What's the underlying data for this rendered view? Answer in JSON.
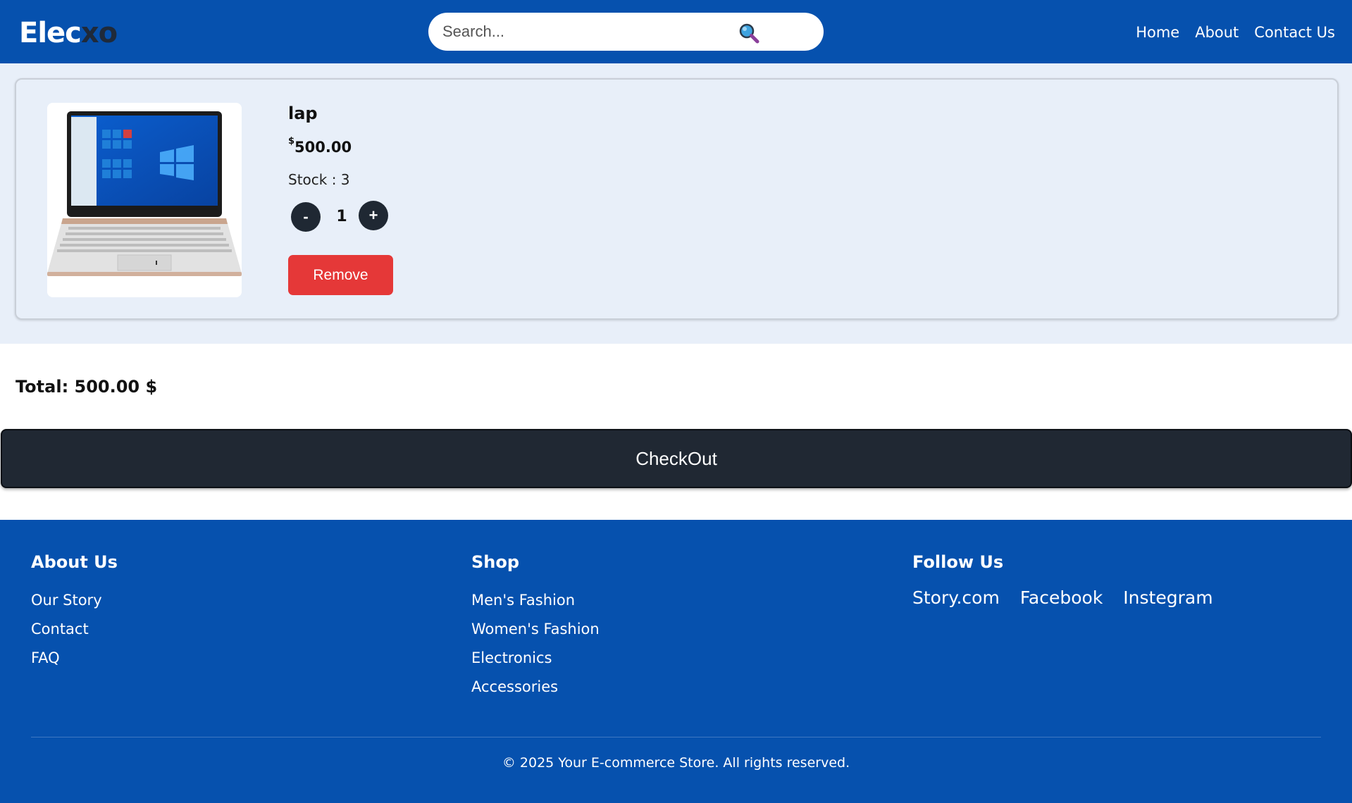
{
  "header": {
    "logo_part1": "Elec",
    "logo_part2": "xo",
    "search_placeholder": "Search...",
    "nav": [
      "Home",
      "About",
      "Contact Us"
    ]
  },
  "cart": {
    "items": [
      {
        "name": "lap",
        "currency_symbol": "$",
        "price": "500.00",
        "stock_label": "Stock : 3",
        "quantity": "1",
        "minus_label": "-",
        "plus_label": "+",
        "remove_label": "Remove"
      }
    ],
    "total_label": "Total: 500.00 $",
    "checkout_label": "CheckOut"
  },
  "footer": {
    "about": {
      "title": "About Us",
      "links": [
        "Our Story",
        "Contact",
        "FAQ"
      ]
    },
    "shop": {
      "title": "Shop",
      "links": [
        "Men's Fashion",
        "Women's Fashion",
        "Electronics",
        "Accessories"
      ]
    },
    "follow": {
      "title": "Follow Us",
      "links": [
        "Story.com",
        "Facebook",
        "Instegram"
      ]
    },
    "copyright": "© 2025 Your E-commerce Store. All rights reserved."
  },
  "colors": {
    "primary_blue": "#0651ae",
    "dark": "#202833",
    "danger": "#e53838",
    "cart_bg": "#e8eff9"
  }
}
